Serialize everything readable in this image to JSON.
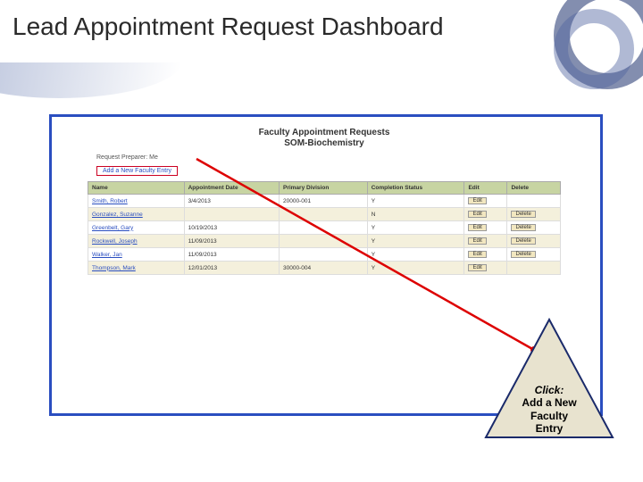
{
  "title": "Lead Appointment Request Dashboard",
  "screenshot": {
    "heading": "Faculty Appointment Requests",
    "subheading": "SOM-Biochemistry",
    "request_preparer_label": "Request Preparer:",
    "request_preparer_value": "Me",
    "add_link": "Add a New Faculty Entry",
    "columns": [
      "Name",
      "Appointment Date",
      "Primary Division",
      "Completion Status",
      "Edit",
      "Delete"
    ],
    "rows": [
      {
        "name": "Smith, Robert",
        "date": "3/4/2013",
        "division": "20000-001",
        "status": "Y",
        "edit": "Edit",
        "delete": ""
      },
      {
        "name": "Gonzalez, Suzanne",
        "date": "",
        "division": "",
        "status": "N",
        "edit": "Edit",
        "delete": "Delete"
      },
      {
        "name": "Greenbelt, Gary",
        "date": "10/19/2013",
        "division": "",
        "status": "Y",
        "edit": "Edit",
        "delete": "Delete"
      },
      {
        "name": "Rockwell, Joseph",
        "date": "11/09/2013",
        "division": "",
        "status": "Y",
        "edit": "Edit",
        "delete": "Delete"
      },
      {
        "name": "Walker, Jan",
        "date": "11/09/2013",
        "division": "",
        "status": "Y",
        "edit": "Edit",
        "delete": "Delete"
      },
      {
        "name": "Thompson, Mark",
        "date": "12/01/2013",
        "division": "30000-004",
        "status": "Y",
        "edit": "Edit",
        "delete": ""
      }
    ]
  },
  "callout": {
    "line1": "Click:",
    "line2": "Add a New",
    "line3": "Faculty",
    "line4": "Entry"
  }
}
